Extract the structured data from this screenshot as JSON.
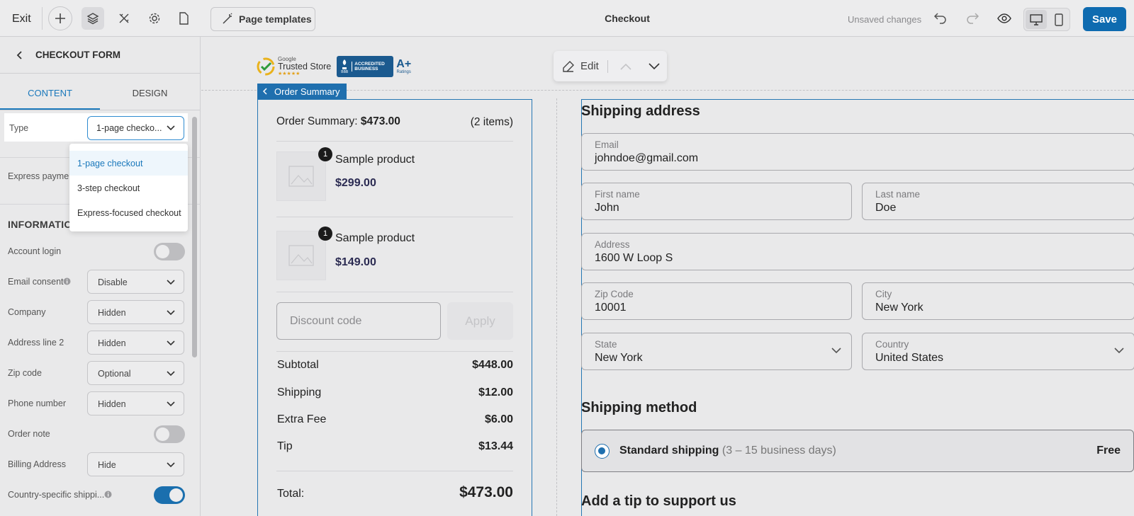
{
  "topbar": {
    "exit_label": "Exit",
    "page_templates_label": "Page templates",
    "title": "Checkout",
    "unsaved_text": "Unsaved changes",
    "save_label": "Save"
  },
  "sidebar": {
    "title": "CHECKOUT FORM",
    "tabs": [
      {
        "label": "CONTENT"
      },
      {
        "label": "DESIGN"
      }
    ],
    "type_label": "Type",
    "type_value": "1-page checko...",
    "type_options": [
      "1-page checkout",
      "3-step checkout",
      "Express-focused checkout"
    ],
    "express_label": "Express paymen",
    "information_title": "INFORMATIO",
    "settings": [
      {
        "label": "Account login",
        "kind": "toggle",
        "on": false
      },
      {
        "label": "Email consent",
        "kind": "select",
        "value": "Disable"
      },
      {
        "label": "Company",
        "kind": "select",
        "value": "Hidden"
      },
      {
        "label": "Address line 2",
        "kind": "select",
        "value": "Hidden"
      },
      {
        "label": "Zip code",
        "kind": "select",
        "value": "Optional"
      },
      {
        "label": "Phone number",
        "kind": "select",
        "value": "Hidden"
      },
      {
        "label": "Order note",
        "kind": "toggle",
        "on": false
      },
      {
        "label": "Billing Address",
        "kind": "select",
        "value": "Hide"
      },
      {
        "label": "Country-specific shippi...",
        "kind": "toggle",
        "on": true
      }
    ]
  },
  "badges": {
    "google_small": "Google",
    "google_main": "Trusted Store",
    "stars": "★★★★★",
    "bbb_line1": "ACCREDITED",
    "bbb_line2": "BUSINESS",
    "bbb_small": "BBB",
    "aplus": "A+",
    "ratings": "Ratings"
  },
  "editbar": {
    "edit_label": "Edit"
  },
  "order_summary": {
    "tag_label": "Order Summary",
    "heading_label": "Order Summary:",
    "heading_total": "$473.00",
    "item_count": "(2 items)",
    "products": [
      {
        "name": "Sample product",
        "price": "$299.00",
        "qty": "1"
      },
      {
        "name": "Sample product",
        "price": "$149.00",
        "qty": "1"
      }
    ],
    "discount_placeholder": "Discount code",
    "apply_label": "Apply",
    "lines": [
      {
        "label": "Subtotal",
        "value": "$448.00"
      },
      {
        "label": "Shipping",
        "value": "$12.00"
      },
      {
        "label": "Extra Fee",
        "value": "$6.00"
      },
      {
        "label": "Tip",
        "value": "$13.44"
      }
    ],
    "total_label": "Total:",
    "total_value": "$473.00"
  },
  "shipping_address": {
    "title": "Shipping address",
    "email": {
      "label": "Email",
      "value": "johndoe@gmail.com"
    },
    "first_name": {
      "label": "First name",
      "value": "John"
    },
    "last_name": {
      "label": "Last name",
      "value": "Doe"
    },
    "address": {
      "label": "Address",
      "value": "1600 W Loop S"
    },
    "zip": {
      "label": "Zip Code",
      "value": "10001"
    },
    "city": {
      "label": "City",
      "value": "New York"
    },
    "state": {
      "label": "State",
      "value": "New York"
    },
    "country": {
      "label": "Country",
      "value": "United States"
    }
  },
  "shipping_method": {
    "title": "Shipping method",
    "option_name": "Standard shipping",
    "option_days": " (3 – 15 business days)",
    "option_price": "Free"
  },
  "tip": {
    "title": "Add a tip to support us"
  },
  "colors": {
    "accent": "#1a78bb",
    "save": "#0e6bb0",
    "border_blue": "#2677b3"
  }
}
